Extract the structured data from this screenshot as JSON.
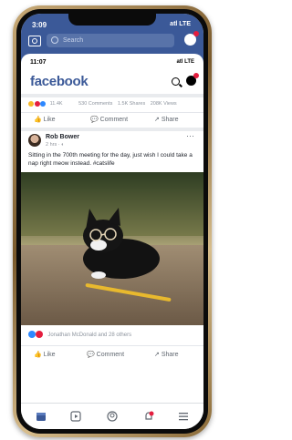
{
  "old_bar": {
    "time": "3:09",
    "signal": "atl LTE",
    "search_placeholder": "Search"
  },
  "status": {
    "time": "11:07",
    "signal": "atl LTE"
  },
  "header": {
    "logo": "facebook"
  },
  "prev_post_stats": {
    "reactions_count": "11.4K",
    "comments": "530 Comments",
    "shares": "1.5K Shares",
    "views": "208K Views"
  },
  "actions": {
    "like": "Like",
    "comment": "Comment",
    "share": "Share"
  },
  "post": {
    "author": "Rob Bower",
    "time": "2 hrs · ",
    "text": "Sitting in the 700th meeting for the day, just wish I could take a nap right meow instead. #catslife",
    "likes_text": "Jonathan McDonald and 28 others"
  },
  "colors": {
    "brand": "#3b5998",
    "like_blue": "#2d88ff",
    "love_red": "#e41e3f",
    "haha_yellow": "#f7b928"
  },
  "icons": [
    "camera-icon",
    "search-icon",
    "messenger-icon",
    "more-icon",
    "like-icon",
    "comment-icon",
    "share-icon",
    "home-icon",
    "video-icon",
    "profile-icon",
    "bell-icon",
    "menu-icon"
  ]
}
